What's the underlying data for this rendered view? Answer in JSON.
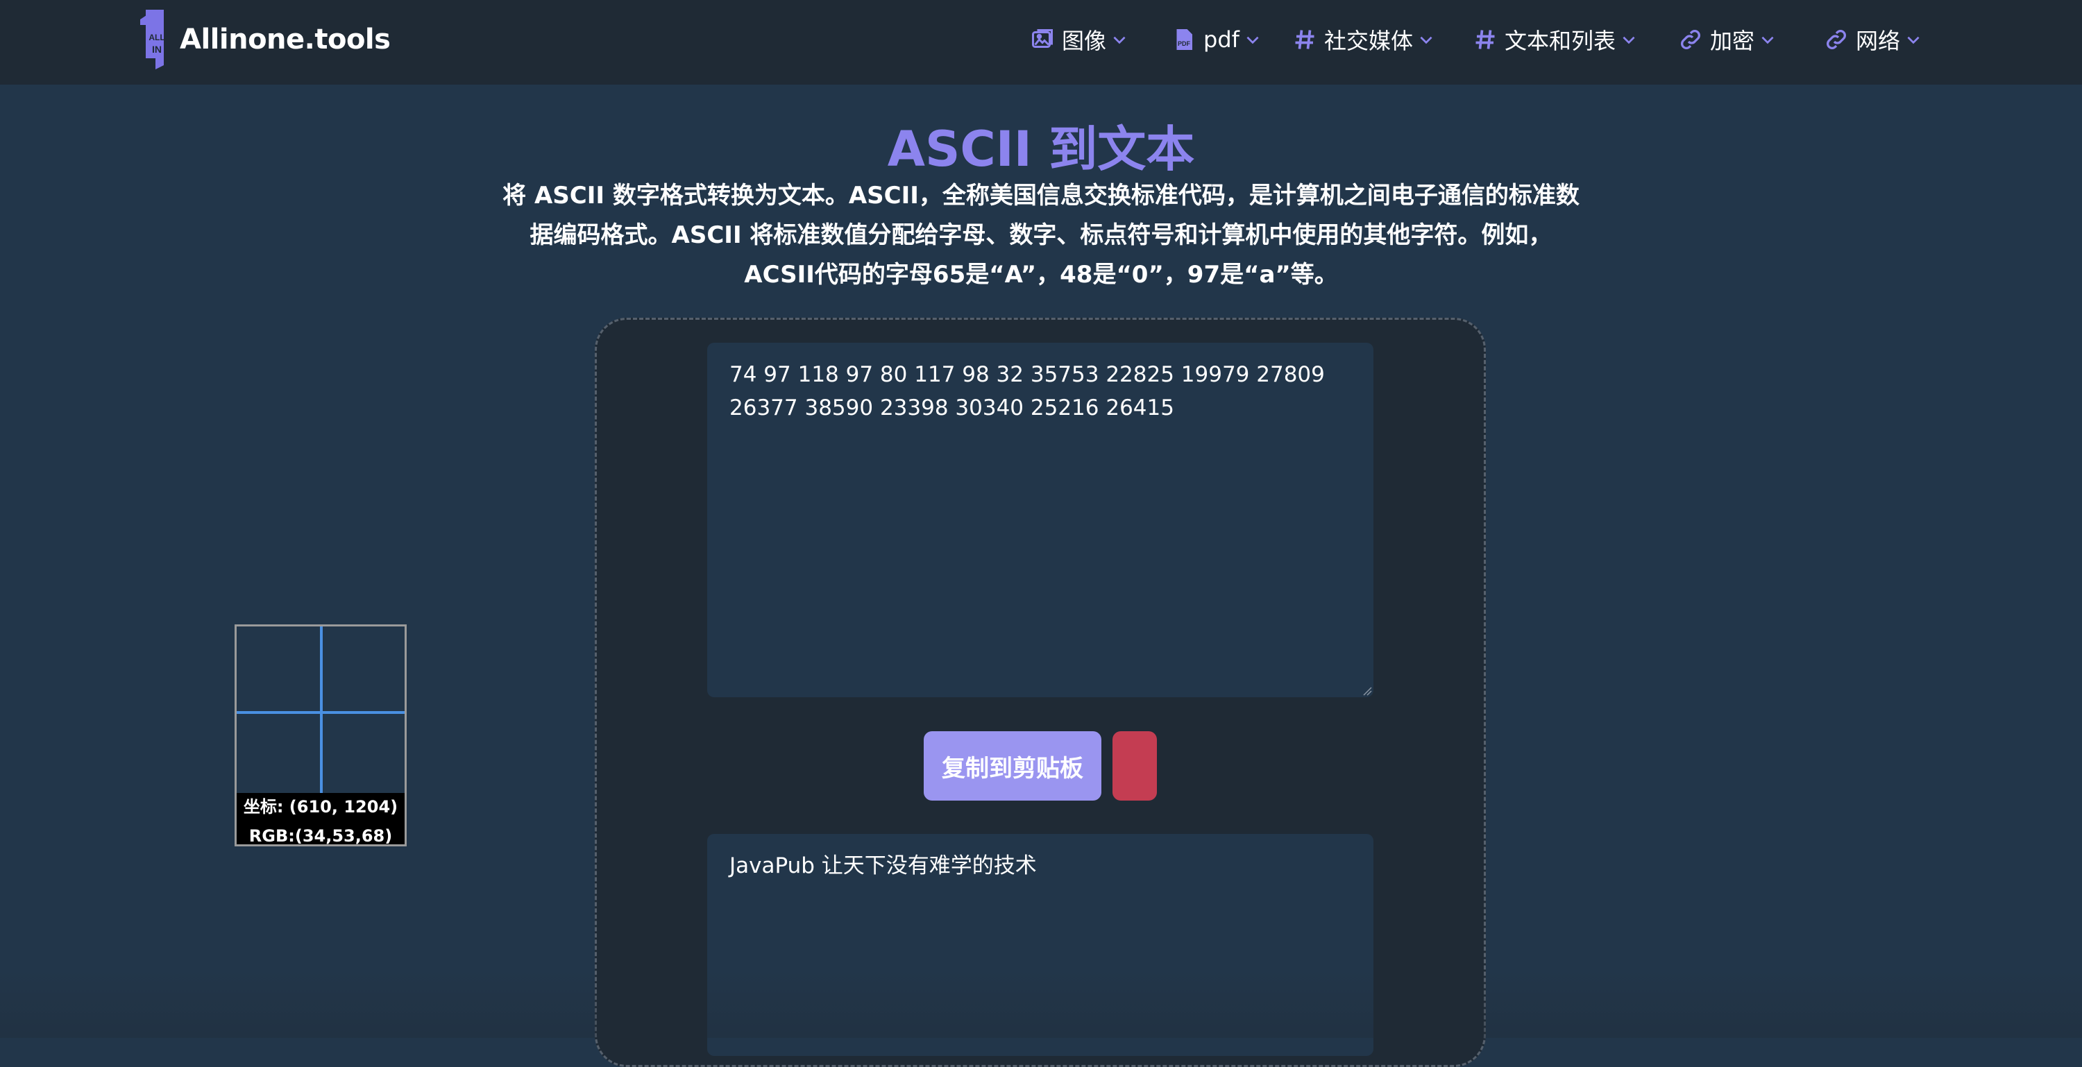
{
  "header": {
    "brand": "Allinone.tools",
    "logo_text_top": "ALL",
    "logo_text_bottom": "IN",
    "nav": [
      {
        "label": "图像",
        "icon": "image-icon"
      },
      {
        "label": "pdf",
        "icon": "pdf-file-icon"
      },
      {
        "label": "社交媒体",
        "icon": "hashtag-icon"
      },
      {
        "label": "文本和列表",
        "icon": "hashtag-icon"
      },
      {
        "label": "加密",
        "icon": "link-icon"
      },
      {
        "label": "网络",
        "icon": "link-icon"
      }
    ]
  },
  "page": {
    "title": "ASCII 到文本",
    "description": "将 ASCII 数字格式转换为文本。ASCII，全称美国信息交换标准代码，是计算机之间电子通信的标准数据编码格式。ASCII 将标准数值分配给字母、数字、标点符号和计算机中使用的其他字符。例如，ACSII代码的字母65是“A”，48是“0”，97是“a”等。"
  },
  "tool": {
    "input_value": "74 97 118 97 80 117 98 32 35753 22825 19979 27809\n26377 38590 23398 30340 25216 26415",
    "copy_label": "复制到剪贴板",
    "output_value": "JavaPub 让天下没有难学的技术"
  },
  "magnifier": {
    "coords": "坐标: (610, 1204)",
    "rgb": "RGB:(34,53,68)"
  },
  "colors": {
    "accent": "#8c84ee",
    "button": "#9a95f0",
    "danger": "#c43d52",
    "bg": "#22364a",
    "panel": "#1f2a35"
  }
}
